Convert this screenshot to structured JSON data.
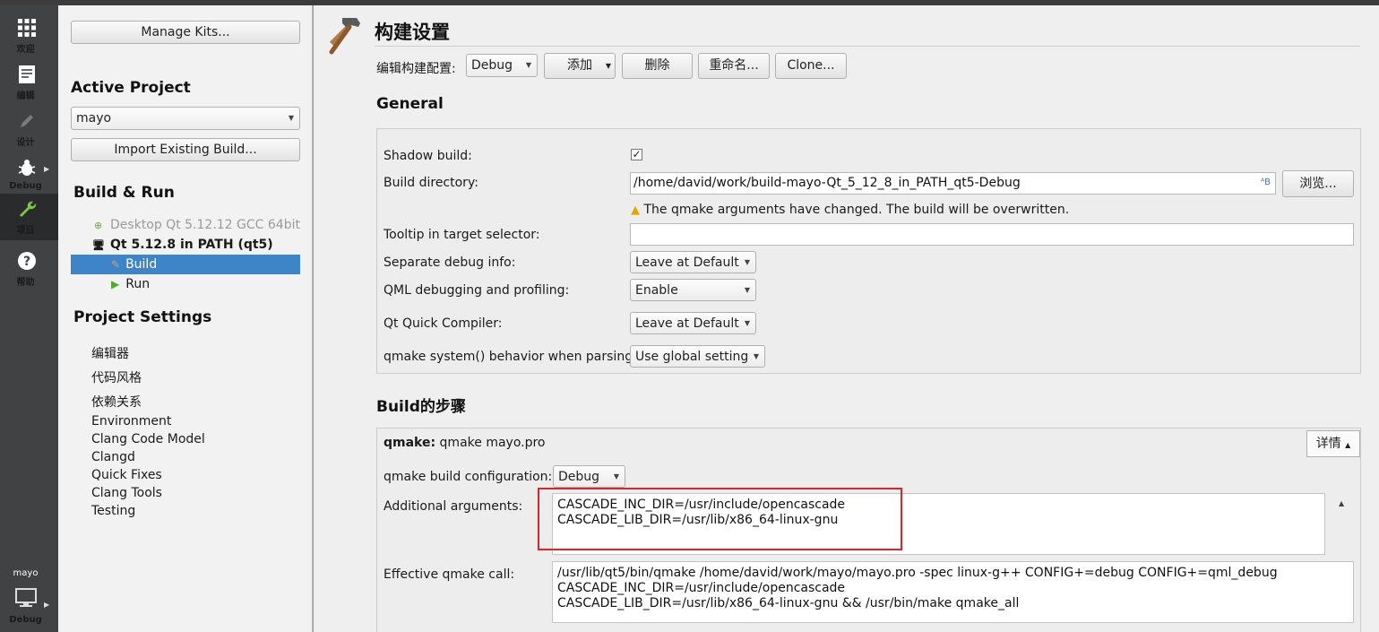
{
  "modes": [
    {
      "label": "欢迎",
      "icon": "grid-icon"
    },
    {
      "label": "编辑",
      "icon": "document-icon"
    },
    {
      "label": "设计",
      "icon": "pencil-icon"
    },
    {
      "label": "Debug",
      "icon": "bug-icon"
    },
    {
      "label": "项目",
      "icon": "wrench-icon"
    },
    {
      "label": "帮助",
      "icon": "help-icon"
    }
  ],
  "kit_selector": {
    "project": "mayo",
    "label": "Debug"
  },
  "sidebar": {
    "manage_kits": "Manage Kits...",
    "active_project_title": "Active Project",
    "project_combo": "mayo",
    "import_build": "Import Existing Build...",
    "build_run_title": "Build & Run",
    "kits": [
      {
        "label": "Desktop Qt 5.12.12 GCC 64bit"
      },
      {
        "label": "Qt 5.12.8 in PATH (qt5)"
      }
    ],
    "build_item": "Build",
    "run_item": "Run",
    "project_settings_title": "Project Settings",
    "settings_items": [
      "编辑器",
      "代码风格",
      "依赖关系",
      "Environment",
      "Clang Code Model",
      "Clangd",
      "Quick Fixes",
      "Clang Tools",
      "Testing"
    ]
  },
  "main": {
    "title": "构建设置",
    "edit_config_label": "编辑构建配置:",
    "config_combo": "Debug",
    "add_button": "添加",
    "delete_button": "删除",
    "rename_button": "重命名...",
    "clone_button": "Clone...",
    "general_title": "General",
    "shadow_build_label": "Shadow build:",
    "shadow_build_check": "✓",
    "build_dir_label": "Build directory:",
    "build_dir_value": "/home/david/work/build-mayo-Qt_5_12_8_in_PATH_qt5-Debug",
    "browse_button": "浏览...",
    "warning_text": "The qmake arguments have changed. The build will be overwritten.",
    "tooltip_label": "Tooltip in target selector:",
    "tooltip_value": "",
    "sep_debug_label": "Separate debug info:",
    "sep_debug_value": "Leave at Default",
    "qml_debug_label": "QML debugging and profiling:",
    "qml_debug_value": "Enable",
    "quick_compiler_label": "Qt Quick Compiler:",
    "quick_compiler_value": "Leave at Default",
    "qmake_system_label": "qmake system() behavior when parsing:",
    "qmake_system_value": "Use global setting",
    "build_steps_title": "Build的步骤",
    "step_name": "qmake:",
    "step_summary": "qmake mayo.pro",
    "details_button": "详情",
    "qmake_build_config_label": "qmake build configuration:",
    "qmake_build_config_value": "Debug",
    "additional_args_label": "Additional arguments:",
    "additional_args_value": "CASCADE_INC_DIR=/usr/include/opencascade\nCASCADE_LIB_DIR=/usr/lib/x86_64-linux-gnu",
    "effective_call_label": "Effective qmake call:",
    "effective_call_value": "/usr/lib/qt5/bin/qmake /home/david/work/mayo/mayo.pro -spec linux-g++ CONFIG+=debug CONFIG+=qml_debug\nCASCADE_INC_DIR=/usr/include/opencascade\nCASCADE_LIB_DIR=/usr/lib/x86_64-linux-gnu && /usr/bin/make qmake_all"
  }
}
